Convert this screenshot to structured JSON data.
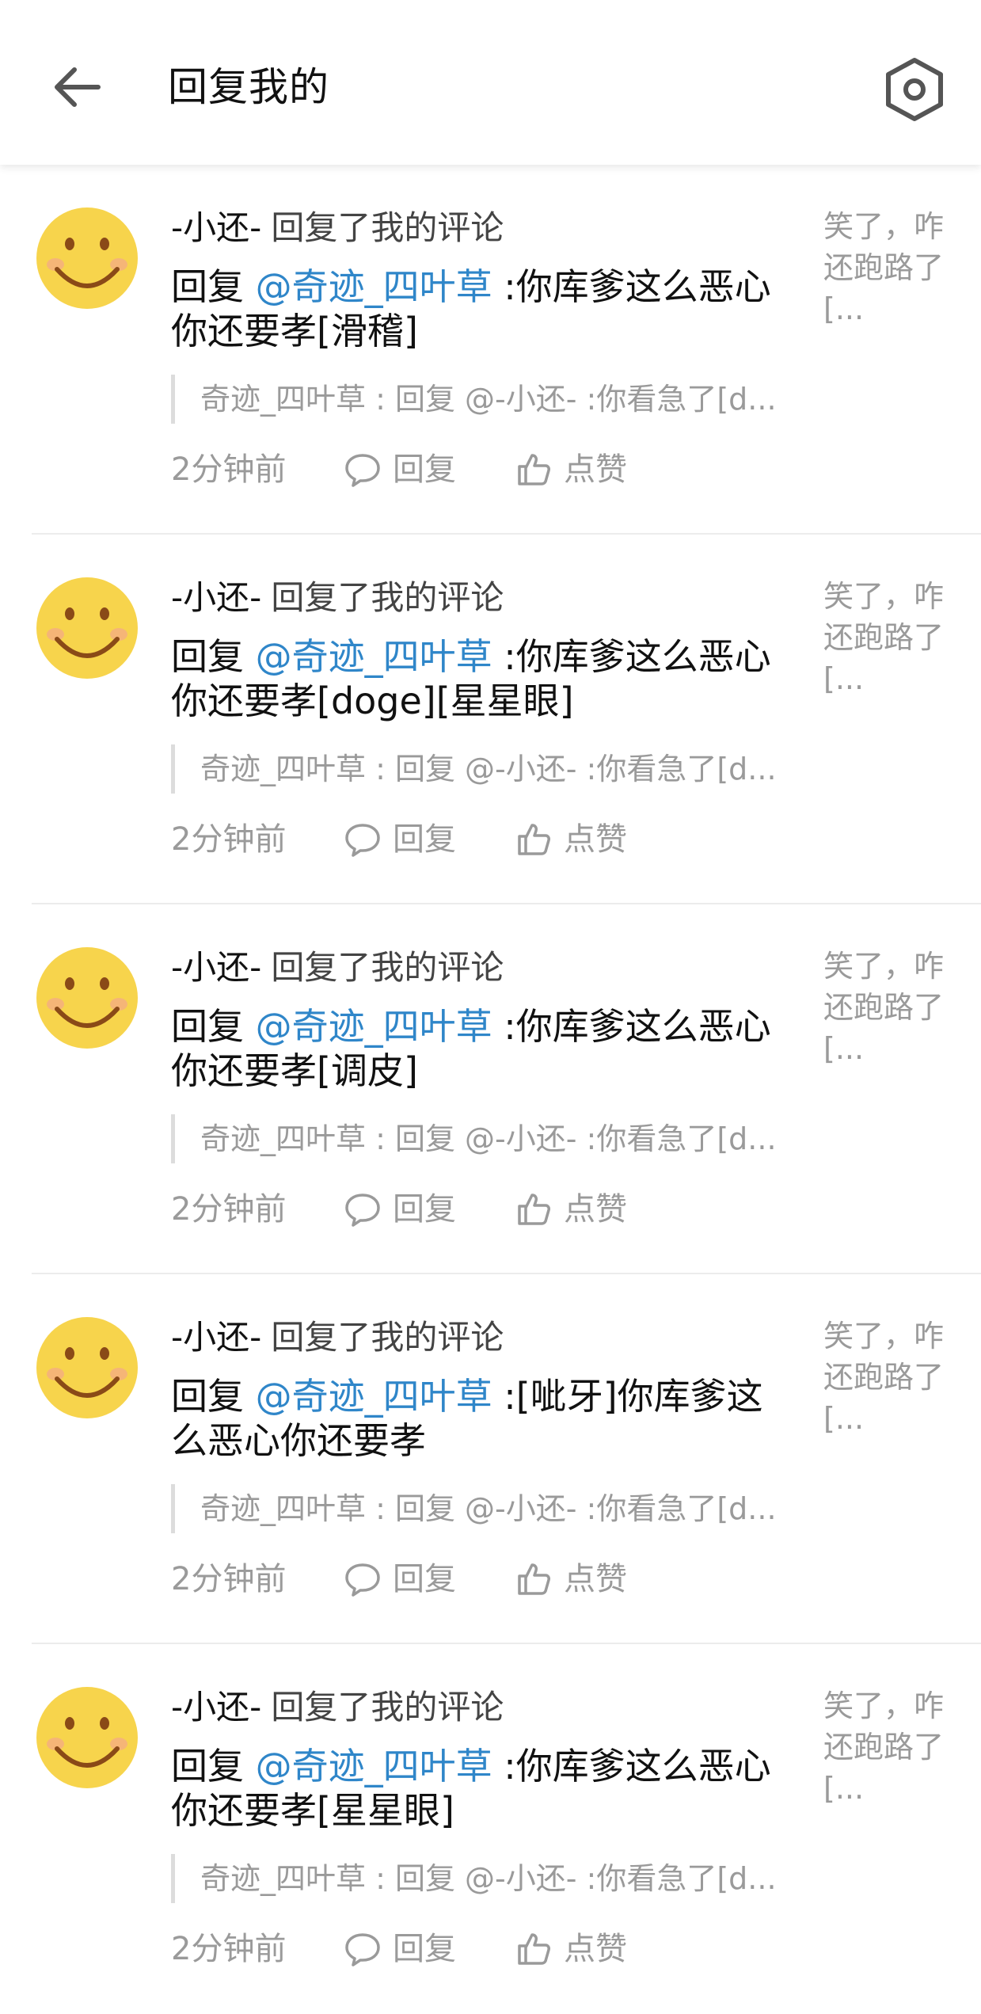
{
  "header": {
    "title": "回复我的",
    "back_icon": "arrow-left-icon",
    "settings_icon": "hexagon-settings-icon"
  },
  "items": [
    {
      "author": "-小还-",
      "action": "回复了我的评论",
      "reply_prefix": "回复 ",
      "mention": "@奇迹_四叶草",
      "text": " :你库爹这么恶心你还要孝[滑稽]",
      "quote": "奇迹_四叶草 : 回复 @-小还- :你看急了[d...",
      "time": "2分钟前",
      "reply_label": "回复",
      "like_label": "点赞",
      "preview": "笑了，咋还跑路了[..."
    },
    {
      "author": "-小还-",
      "action": "回复了我的评论",
      "reply_prefix": "回复 ",
      "mention": "@奇迹_四叶草",
      "text": " :你库爹这么恶心你还要孝[doge][星星眼]",
      "quote": "奇迹_四叶草 : 回复 @-小还- :你看急了[d...",
      "time": "2分钟前",
      "reply_label": "回复",
      "like_label": "点赞",
      "preview": "笑了，咋还跑路了[..."
    },
    {
      "author": "-小还-",
      "action": "回复了我的评论",
      "reply_prefix": "回复 ",
      "mention": "@奇迹_四叶草",
      "text": " :你库爹这么恶心你还要孝[调皮]",
      "quote": "奇迹_四叶草 : 回复 @-小还- :你看急了[d...",
      "time": "2分钟前",
      "reply_label": "回复",
      "like_label": "点赞",
      "preview": "笑了，咋还跑路了[..."
    },
    {
      "author": "-小还-",
      "action": "回复了我的评论",
      "reply_prefix": "回复 ",
      "mention": "@奇迹_四叶草",
      "text": " :[呲牙]你库爹这么恶心你还要孝",
      "quote": "奇迹_四叶草 : 回复 @-小还- :你看急了[d...",
      "time": "2分钟前",
      "reply_label": "回复",
      "like_label": "点赞",
      "preview": "笑了，咋还跑路了[..."
    },
    {
      "author": "-小还-",
      "action": "回复了我的评论",
      "reply_prefix": "回复 ",
      "mention": "@奇迹_四叶草",
      "text": " :你库爹这么恶心你还要孝[星星眼]",
      "quote": "奇迹_四叶草 : 回复 @-小还- :你看急了[d...",
      "time": "2分钟前",
      "reply_label": "回复",
      "like_label": "点赞",
      "preview": "笑了，咋还跑路了[..."
    }
  ],
  "colors": {
    "mention": "#2f86c9",
    "secondary_text": "#9a9a9a",
    "avatar_face": "#f7d44c",
    "avatar_mouth": "#8a4a17"
  }
}
